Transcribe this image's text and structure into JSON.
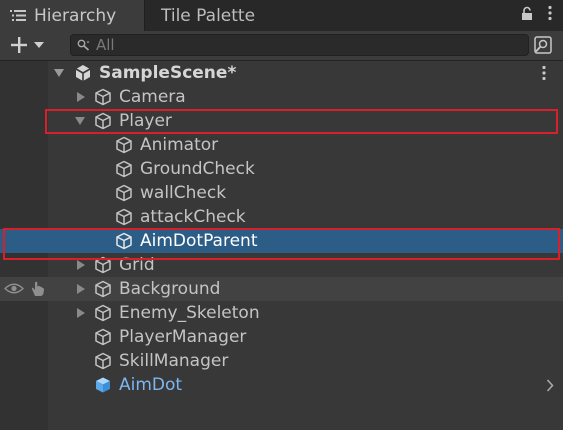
{
  "tabs": [
    {
      "label": "Hierarchy",
      "active": true,
      "icon": "hamburger-list-icon"
    },
    {
      "label": "Tile Palette",
      "active": false
    }
  ],
  "tab_actions": [
    "lock-icon",
    "kebab-menu-icon"
  ],
  "toolbar": {
    "add_icon": "plus-icon",
    "search_placeholder": "All",
    "search_icon": "search-icon",
    "search_options_icon": "search-options-icon"
  },
  "scene": {
    "name": "SampleScene*",
    "icon": "unity-logo-icon"
  },
  "rows": [
    {
      "label": "Camera",
      "depth": 1,
      "expanded": false,
      "has_children": true
    },
    {
      "label": "Player",
      "depth": 1,
      "expanded": true,
      "has_children": true,
      "highlighted": true
    },
    {
      "label": "Animator",
      "depth": 2
    },
    {
      "label": "GroundCheck",
      "depth": 2
    },
    {
      "label": "wallCheck",
      "depth": 2
    },
    {
      "label": "attackCheck",
      "depth": 2
    },
    {
      "label": "AimDotParent",
      "depth": 2,
      "selected": true,
      "highlighted": true
    },
    {
      "label": "Grid",
      "depth": 1,
      "has_children": true
    },
    {
      "label": "Background",
      "depth": 1,
      "has_children": true,
      "hovered": true
    },
    {
      "label": "Enemy_Skeleton",
      "depth": 1,
      "has_children": true
    },
    {
      "label": "PlayerManager",
      "depth": 1
    },
    {
      "label": "SkillManager",
      "depth": 1
    },
    {
      "label": "AimDot",
      "depth": 1,
      "prefab": true
    }
  ],
  "colors": {
    "selection": "#2c5d87",
    "highlight_box": "#d8202a",
    "prefab_text": "#7cb7f2",
    "panel_bg": "#383838"
  }
}
